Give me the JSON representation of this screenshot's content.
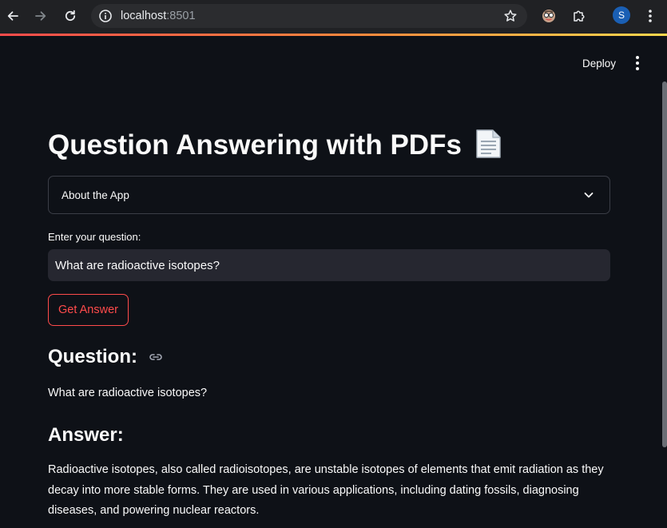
{
  "browser": {
    "url_host": "localhost",
    "url_port": ":8501",
    "profile_initial": "S"
  },
  "header": {
    "deploy_label": "Deploy"
  },
  "main": {
    "title": "Question Answering with PDFs",
    "title_emoji_icon": "page-document-icon",
    "expander_label": "About the App",
    "input_label": "Enter your question:",
    "input_value": "What are radioactive isotopes?",
    "button_label": "Get Answer",
    "question_heading": "Question:",
    "question_text": "What are radioactive isotopes?",
    "answer_heading": "Answer:",
    "answer_text": "Radioactive isotopes, also called radioisotopes, are unstable isotopes of elements that emit radiation as they decay into more stable forms. They are used in various applications, including dating fossils, diagnosing diseases, and powering nuclear reactors."
  },
  "colors": {
    "background": "#0e1117",
    "accent": "#ff4b4b",
    "input_bg": "#262730",
    "text": "#fafafa"
  }
}
